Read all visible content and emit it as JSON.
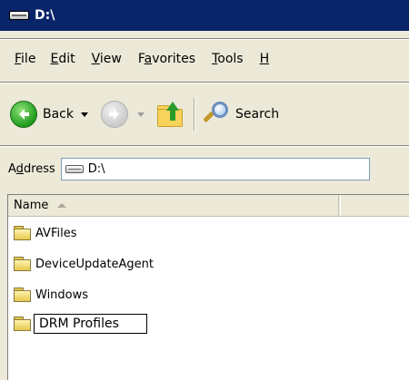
{
  "window": {
    "title": "D:\\"
  },
  "menu": {
    "items": [
      {
        "label": "File",
        "accel": "F",
        "rest": "ile"
      },
      {
        "label": "Edit",
        "accel": "E",
        "rest": "dit"
      },
      {
        "label": "View",
        "accel": "V",
        "rest": "iew"
      },
      {
        "label": "Favorites",
        "pre": "F",
        "accel": "a",
        "rest": "vorites"
      },
      {
        "label": "Tools",
        "accel": "T",
        "rest": "ools"
      },
      {
        "label": "H",
        "accel": "H",
        "rest": ""
      }
    ]
  },
  "toolbar": {
    "back_label": "Back",
    "search_label": "Search"
  },
  "address": {
    "label_pre": "A",
    "label_accel": "d",
    "label_rest": "dress",
    "value": "D:\\"
  },
  "list": {
    "column_name": "Name",
    "items": [
      {
        "name": "AVFiles"
      },
      {
        "name": "DeviceUpdateAgent"
      },
      {
        "name": "Windows"
      },
      {
        "name": "DRM Profiles",
        "editing": true
      }
    ]
  },
  "colors": {
    "titlebar": "#0a246a",
    "chrome": "#ece9d8",
    "folder": "#e7c94d",
    "back_button": "#1f9a1b"
  }
}
